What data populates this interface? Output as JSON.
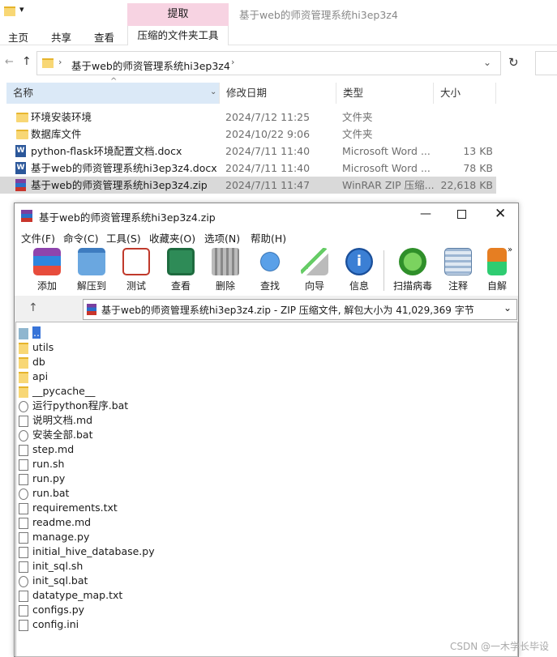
{
  "explorer": {
    "extract_tab": "提取",
    "window_title": "基于web的师资管理系统hi3ep3z4",
    "ribbon_tabs": [
      "主页",
      "共享",
      "查看"
    ],
    "tools_tab": "压缩的文件夹工具",
    "address": "基于web的师资管理系统hi3ep3z4",
    "columns": {
      "name": "名称",
      "modified": "修改日期",
      "type": "类型",
      "size": "大小"
    },
    "files": [
      {
        "name": "环境安装环境",
        "modified": "2024/7/12 11:25",
        "type": "文件夹",
        "size": ""
      },
      {
        "name": "数据库文件",
        "modified": "2024/10/22 9:06",
        "type": "文件夹",
        "size": ""
      },
      {
        "name": "python-flask环境配置文档.docx",
        "modified": "2024/7/11 11:40",
        "type": "Microsoft Word ...",
        "size": "13 KB"
      },
      {
        "name": "基于web的师资管理系统hi3ep3z4.docx",
        "modified": "2024/7/11 11:40",
        "type": "Microsoft Word ...",
        "size": "78 KB"
      },
      {
        "name": "基于web的师资管理系统hi3ep3z4.zip",
        "modified": "2024/7/11 11:47",
        "type": "WinRAR ZIP 压缩...",
        "size": "22,618 KB"
      }
    ]
  },
  "rar": {
    "title": "基于web的师资管理系统hi3ep3z4.zip",
    "menu": [
      "文件(F)",
      "命令(C)",
      "工具(S)",
      "收藏夹(O)",
      "选项(N)",
      "帮助(H)"
    ],
    "toolbar": [
      "添加",
      "解压到",
      "测试",
      "查看",
      "删除",
      "查找",
      "向导",
      "信息",
      "扫描病毒",
      "注释",
      "自解"
    ],
    "path": "基于web的师资管理系统hi3ep3z4.zip - ZIP 压缩文件, 解包大小为 41,029,369 字节",
    "entries": [
      {
        "name": "..",
        "kind": "up"
      },
      {
        "name": "utils",
        "kind": "folder"
      },
      {
        "name": "db",
        "kind": "folder"
      },
      {
        "name": "api",
        "kind": "folder"
      },
      {
        "name": "__pycache__",
        "kind": "folder"
      },
      {
        "name": "运行python程序.bat",
        "kind": "bat"
      },
      {
        "name": "说明文档.md",
        "kind": "doc"
      },
      {
        "name": "安装全部.bat",
        "kind": "bat"
      },
      {
        "name": "step.md",
        "kind": "doc"
      },
      {
        "name": "run.sh",
        "kind": "doc"
      },
      {
        "name": "run.py",
        "kind": "doc"
      },
      {
        "name": "run.bat",
        "kind": "bat"
      },
      {
        "name": "requirements.txt",
        "kind": "doc"
      },
      {
        "name": "readme.md",
        "kind": "doc"
      },
      {
        "name": "manage.py",
        "kind": "doc"
      },
      {
        "name": "initial_hive_database.py",
        "kind": "doc"
      },
      {
        "name": "init_sql.sh",
        "kind": "doc"
      },
      {
        "name": "init_sql.bat",
        "kind": "bat"
      },
      {
        "name": "datatype_map.txt",
        "kind": "doc"
      },
      {
        "name": "configs.py",
        "kind": "doc"
      },
      {
        "name": "config.ini",
        "kind": "doc"
      }
    ]
  },
  "watermark": "CSDN @一木学长毕设"
}
